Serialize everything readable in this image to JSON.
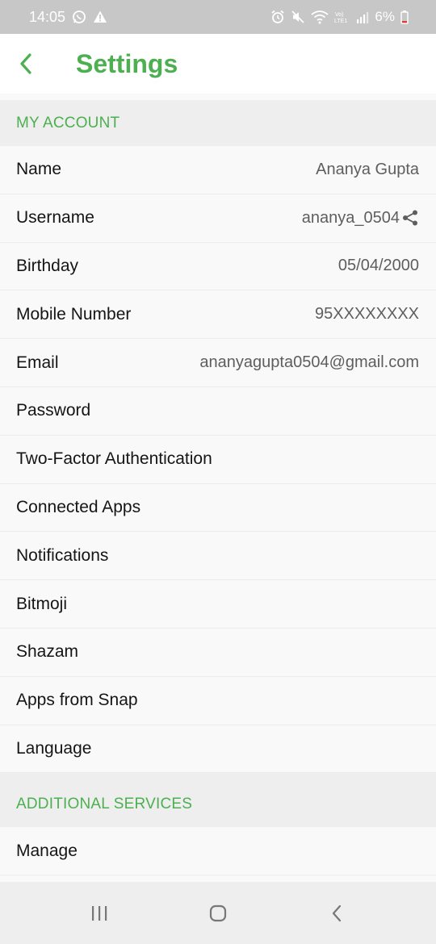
{
  "status_bar": {
    "time": "14:05",
    "battery": "6%",
    "icons": [
      "whatsapp-icon",
      "warning-icon",
      "alarm-icon",
      "mute-icon",
      "wifi-icon",
      "volte-icon",
      "signal-icon",
      "battery-icon"
    ]
  },
  "header": {
    "title": "Settings",
    "back_icon": "back-arrow-icon"
  },
  "my_account": {
    "section_title": "MY ACCOUNT",
    "items": [
      {
        "label": "Name",
        "value": "Ananya Gupta"
      },
      {
        "label": "Username",
        "value": "ananya_0504"
      },
      {
        "label": "Birthday",
        "value": "05/04/2000"
      },
      {
        "label": "Mobile Number",
        "value": "95XXXXXXXX"
      },
      {
        "label": "Email",
        "value": "ananyagupta0504@gmail.com"
      },
      {
        "label": "Password",
        "value": ""
      },
      {
        "label": "Two-Factor Authentication",
        "value": ""
      },
      {
        "label": "Connected Apps",
        "value": ""
      },
      {
        "label": "Notifications",
        "value": ""
      },
      {
        "label": "Bitmoji",
        "value": ""
      },
      {
        "label": "Shazam",
        "value": ""
      },
      {
        "label": "Apps from Snap",
        "value": ""
      },
      {
        "label": "Language",
        "value": ""
      }
    ]
  },
  "additional_services": {
    "section_title": "ADDITIONAL SERVICES",
    "items": [
      {
        "label": "Manage"
      }
    ]
  },
  "colors": {
    "accent": "#4caf50",
    "status_bar": "#c7c7c7",
    "section_bg": "#eeeeee",
    "row_bg": "#f9f9f9"
  },
  "nav_bar": {
    "icons": [
      "recent-apps-icon",
      "home-icon",
      "back-icon"
    ]
  }
}
